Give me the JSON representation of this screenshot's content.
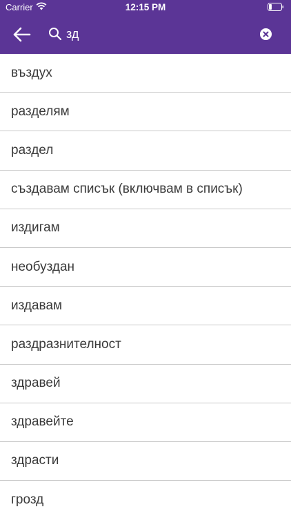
{
  "status_bar": {
    "carrier": "Carrier",
    "time": "12:15 PM"
  },
  "search": {
    "query": "зд"
  },
  "results": [
    "въздух",
    "разделям",
    "раздел",
    "създавам списък (включвам в списък)",
    "издигам",
    "необуздан",
    "издавам",
    "раздразнителност",
    "здравей",
    "здравейте",
    "здрасти",
    "грозд"
  ],
  "colors": {
    "header": "#5b3596",
    "divider": "#c8c8c8",
    "text": "#3a3a3a"
  }
}
